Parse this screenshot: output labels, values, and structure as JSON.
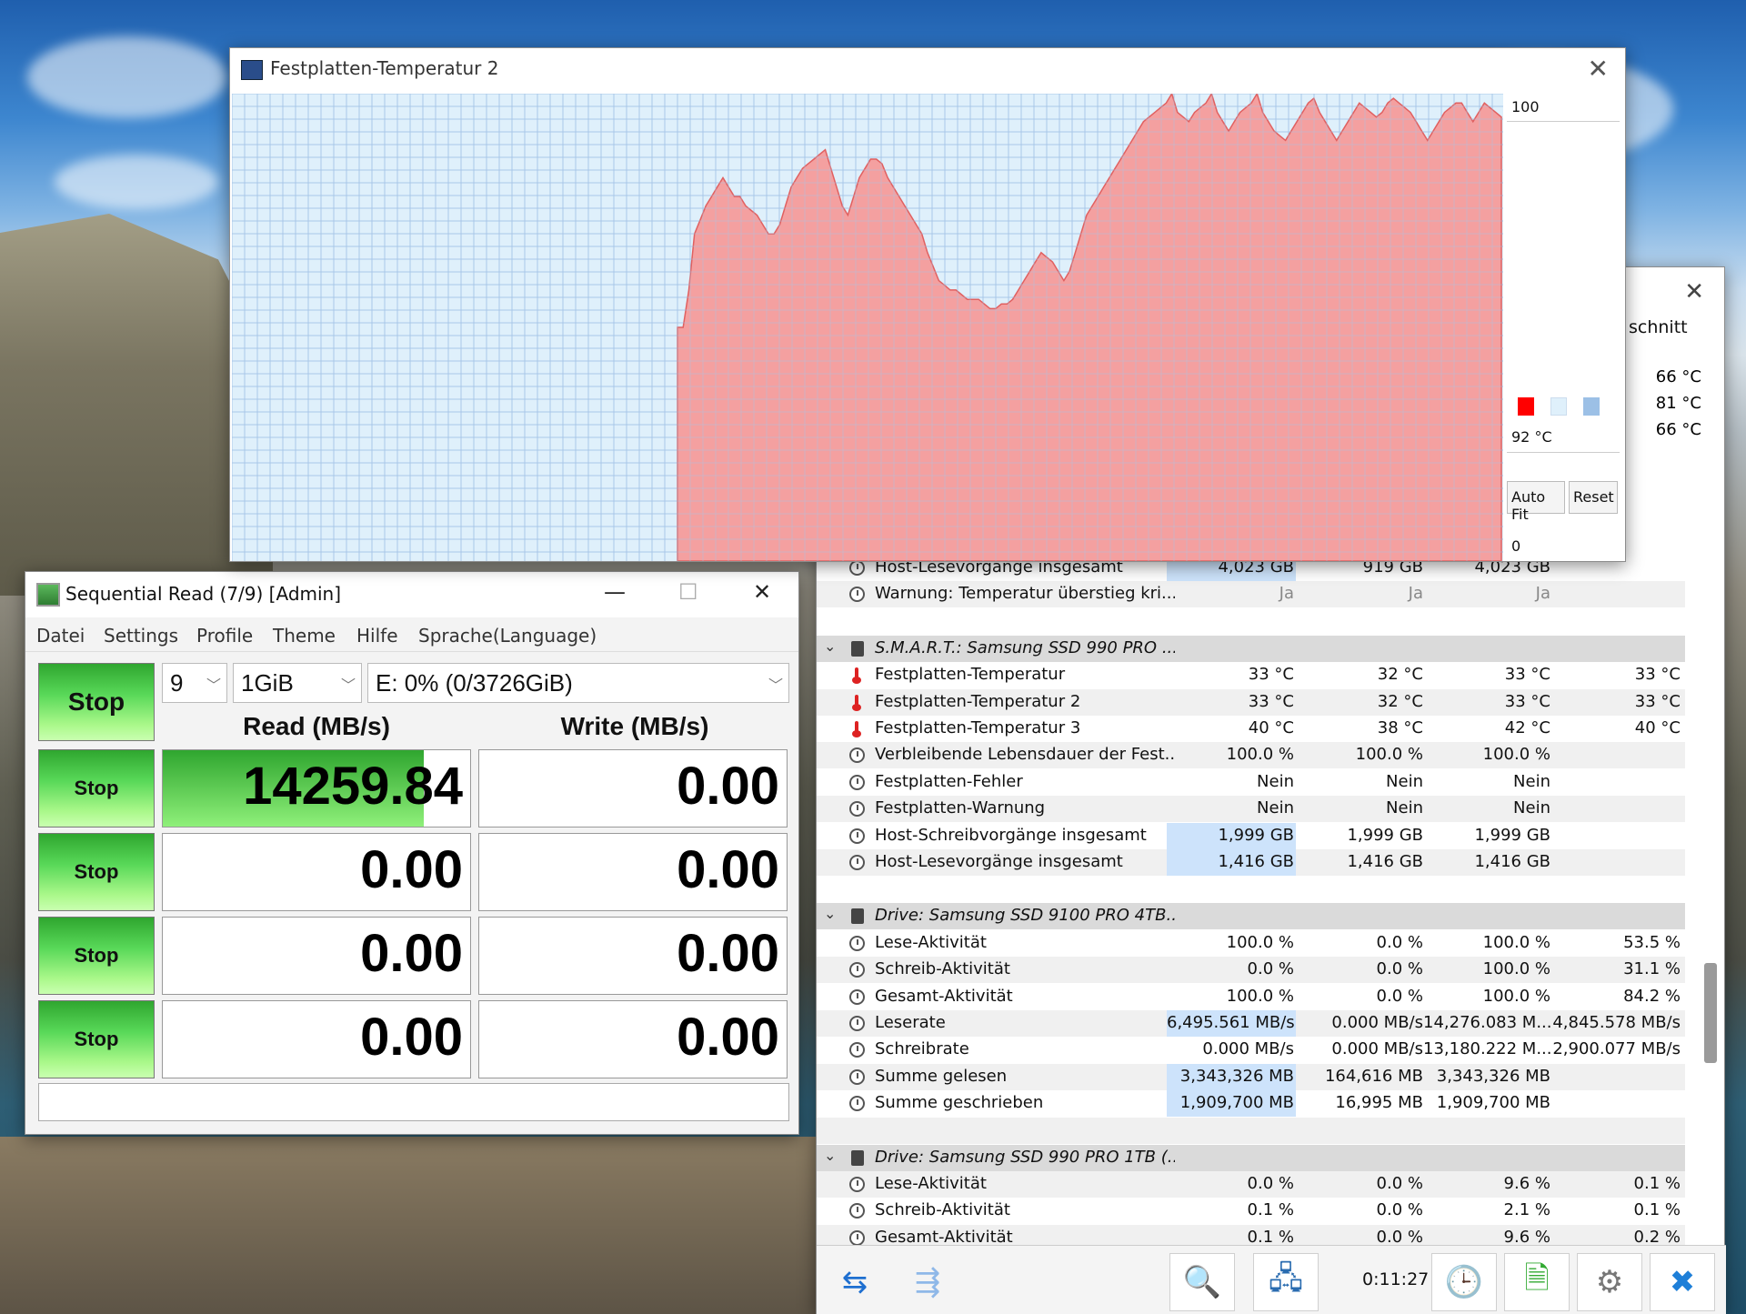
{
  "graph_window": {
    "title": "Festplatten-Temperatur 2",
    "scale_max": "100",
    "current_value": "92 °C",
    "scale_min": "0",
    "auto_fit_label": "Auto Fit",
    "reset_label": "Reset",
    "swatch_colors": [
      "#ff0000",
      "#dff0fb",
      "#9cc0e6"
    ],
    "plot_fill": "#f4a0a0",
    "plot_bg": "#dff0fb",
    "chart_data": {
      "type": "area",
      "ylim": [
        0,
        100
      ],
      "values": [
        50,
        50,
        58,
        70,
        73,
        76,
        78,
        80,
        82,
        80,
        78,
        78,
        76,
        75,
        74,
        72,
        70,
        70,
        72,
        76,
        80,
        82,
        84,
        85,
        86,
        87,
        88,
        84,
        80,
        76,
        74,
        78,
        82,
        84,
        86,
        86,
        85,
        82,
        80,
        78,
        76,
        74,
        72,
        70,
        66,
        63,
        60,
        59,
        58,
        58,
        57,
        56,
        56,
        56,
        55,
        54,
        54,
        55,
        55,
        56,
        58,
        60,
        62,
        64,
        66,
        65,
        64,
        62,
        60,
        62,
        66,
        70,
        74,
        76,
        78,
        80,
        82,
        84,
        86,
        88,
        90,
        92,
        94,
        95,
        96,
        97,
        98,
        100,
        96,
        95,
        94,
        96,
        97,
        98,
        100,
        96,
        94,
        92,
        94,
        96,
        97,
        98,
        100,
        96,
        94,
        92,
        91,
        90,
        92,
        94,
        96,
        98,
        99,
        96,
        94,
        92,
        90,
        92,
        94,
        96,
        98,
        97,
        96,
        95,
        96,
        98,
        99,
        98,
        97,
        96,
        94,
        92,
        90,
        92,
        94,
        96,
        97,
        98,
        98,
        96,
        94,
        96,
        98,
        97,
        96,
        95
      ]
    }
  },
  "sensor_window": {
    "column_header": "schnitt",
    "top_values": [
      "66 °C",
      "81 °C",
      "66 °C"
    ],
    "rows": [
      {
        "kind": "item",
        "icon": "clock",
        "label": "Host-Lesevorgänge insgesamt",
        "v1": "4,023 GB",
        "v2": "919 GB",
        "v3": "4,023 GB",
        "v4": "",
        "hl": true
      },
      {
        "kind": "item",
        "icon": "clock",
        "label": "Warnung: Temperatur überstieg kri...",
        "v1": "Ja",
        "v2": "Ja",
        "v3": "Ja",
        "v4": "",
        "muted": true
      },
      {
        "kind": "blank"
      },
      {
        "kind": "group",
        "label": "S.M.A.R.T.: Samsung SSD 990 PRO ..."
      },
      {
        "kind": "item",
        "icon": "therm",
        "label": "Festplatten-Temperatur",
        "v1": "33 °C",
        "v2": "32 °C",
        "v3": "33 °C",
        "v4": "33 °C"
      },
      {
        "kind": "item",
        "icon": "therm",
        "label": "Festplatten-Temperatur 2",
        "v1": "33 °C",
        "v2": "32 °C",
        "v3": "33 °C",
        "v4": "33 °C"
      },
      {
        "kind": "item",
        "icon": "therm",
        "label": "Festplatten-Temperatur 3",
        "v1": "40 °C",
        "v2": "38 °C",
        "v3": "42 °C",
        "v4": "40 °C"
      },
      {
        "kind": "item",
        "icon": "clock",
        "label": "Verbleibende Lebensdauer der Fest...",
        "v1": "100.0 %",
        "v2": "100.0 %",
        "v3": "100.0 %",
        "v4": ""
      },
      {
        "kind": "item",
        "icon": "clock",
        "label": "Festplatten-Fehler",
        "v1": "Nein",
        "v2": "Nein",
        "v3": "Nein",
        "v4": ""
      },
      {
        "kind": "item",
        "icon": "clock",
        "label": "Festplatten-Warnung",
        "v1": "Nein",
        "v2": "Nein",
        "v3": "Nein",
        "v4": ""
      },
      {
        "kind": "item",
        "icon": "clock",
        "label": "Host-Schreibvorgänge insgesamt",
        "v1": "1,999 GB",
        "v2": "1,999 GB",
        "v3": "1,999 GB",
        "v4": "",
        "hl": true
      },
      {
        "kind": "item",
        "icon": "clock",
        "label": "Host-Lesevorgänge insgesamt",
        "v1": "1,416 GB",
        "v2": "1,416 GB",
        "v3": "1,416 GB",
        "v4": "",
        "hl": true
      },
      {
        "kind": "blank"
      },
      {
        "kind": "group",
        "label": "Drive: Samsung SSD 9100 PRO 4TB..."
      },
      {
        "kind": "item",
        "icon": "clock",
        "label": "Lese-Aktivität",
        "v1": "100.0 %",
        "v2": "0.0 %",
        "v3": "100.0 %",
        "v4": "53.5 %"
      },
      {
        "kind": "item",
        "icon": "clock",
        "label": "Schreib-Aktivität",
        "v1": "0.0 %",
        "v2": "0.0 %",
        "v3": "100.0 %",
        "v4": "31.1 %"
      },
      {
        "kind": "item",
        "icon": "clock",
        "label": "Gesamt-Aktivität",
        "v1": "100.0 %",
        "v2": "0.0 %",
        "v3": "100.0 %",
        "v4": "84.2 %"
      },
      {
        "kind": "item",
        "icon": "clock",
        "label": "Leserate",
        "v1": "6,495.561 MB/s",
        "v2": "0.000 MB/s",
        "v3": "14,276.083 M...",
        "v4": "4,845.578 MB/s",
        "hl": true
      },
      {
        "kind": "item",
        "icon": "clock",
        "label": "Schreibrate",
        "v1": "0.000 MB/s",
        "v2": "0.000 MB/s",
        "v3": "13,180.222 M...",
        "v4": "2,900.077 MB/s"
      },
      {
        "kind": "item",
        "icon": "clock",
        "label": "Summe gelesen",
        "v1": "3,343,326 MB",
        "v2": "164,616 MB",
        "v3": "3,343,326 MB",
        "v4": "",
        "hl": true
      },
      {
        "kind": "item",
        "icon": "clock",
        "label": "Summe geschrieben",
        "v1": "1,909,700 MB",
        "v2": "16,995 MB",
        "v3": "1,909,700 MB",
        "v4": "",
        "hl": true
      },
      {
        "kind": "blank"
      },
      {
        "kind": "group",
        "label": "Drive: Samsung SSD 990 PRO 1TB (..."
      },
      {
        "kind": "item",
        "icon": "clock",
        "label": "Lese-Aktivität",
        "v1": "0.0 %",
        "v2": "0.0 %",
        "v3": "9.6 %",
        "v4": "0.1 %"
      },
      {
        "kind": "item",
        "icon": "clock",
        "label": "Schreib-Aktivität",
        "v1": "0.1 %",
        "v2": "0.0 %",
        "v3": "2.1 %",
        "v4": "0.1 %"
      },
      {
        "kind": "item",
        "icon": "clock",
        "label": "Gesamt-Aktivität",
        "v1": "0.1 %",
        "v2": "0.0 %",
        "v3": "9.6 %",
        "v4": "0.2 %"
      }
    ],
    "elapsed_time": "0:11:27",
    "toolbar_icons": [
      "arrows-left-right-icon",
      "arrows-collapse-icon",
      "search-computer-icon",
      "network-icon",
      "clock-icon",
      "report-add-icon",
      "gear-icon",
      "close-x-icon"
    ]
  },
  "cdm": {
    "title": "Sequential Read (7/9) [Admin]",
    "menu": [
      "Datei",
      "Settings",
      "Profile",
      "Theme",
      "Hilfe",
      "Sprache(Language)"
    ],
    "main_stop": "Stop",
    "count_value": "9",
    "size_value": "1GiB",
    "drive_value": "E: 0% (0/3726GiB)",
    "read_header": "Read (MB/s)",
    "write_header": "Write (MB/s)",
    "rows": [
      {
        "stop": "Stop",
        "read": "14259.84",
        "write": "0.00",
        "read_progress": 0.85
      },
      {
        "stop": "Stop",
        "read": "0.00",
        "write": "0.00",
        "read_progress": 0
      },
      {
        "stop": "Stop",
        "read": "0.00",
        "write": "0.00",
        "read_progress": 0
      },
      {
        "stop": "Stop",
        "read": "0.00",
        "write": "0.00",
        "read_progress": 0
      }
    ],
    "comment": ""
  }
}
